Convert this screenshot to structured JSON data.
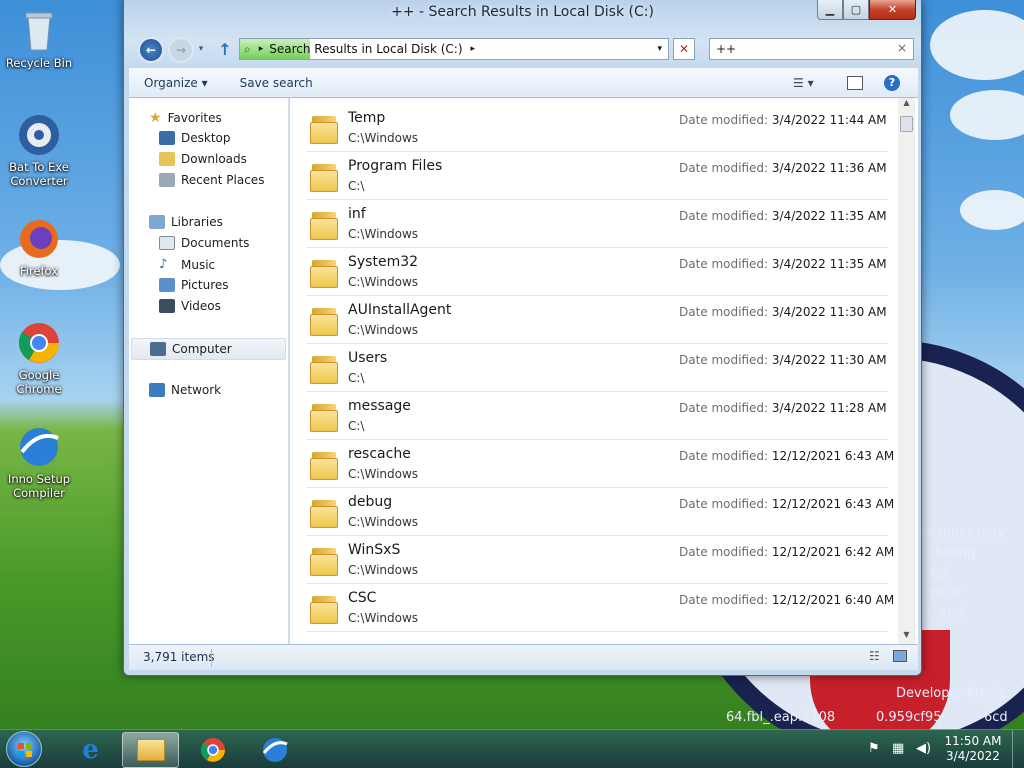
{
  "window": {
    "title": "++ - Search Results in Local Disk (C:)",
    "min": "▁",
    "max": "▢",
    "close": "✕"
  },
  "address": {
    "text": "Search Results in Local Disk (C:)",
    "sep": "▸"
  },
  "search": {
    "value": "++",
    "clear": "×"
  },
  "toolbar": {
    "organize": "Organize ▾",
    "save_search": "Save search"
  },
  "nav": {
    "favorites": "Favorites",
    "desktop": "Desktop",
    "downloads": "Downloads",
    "recent": "Recent Places",
    "libraries": "Libraries",
    "documents": "Documents",
    "music": "Music",
    "pictures": "Pictures",
    "videos": "Videos",
    "computer": "Computer",
    "network": "Network"
  },
  "date_label": "Date modified:",
  "rows": [
    {
      "name": "Temp",
      "path": "C:\\Windows",
      "date": "3/4/2022 11:44 AM"
    },
    {
      "name": "Program Files",
      "path": "C:\\",
      "date": "3/4/2022 11:36 AM"
    },
    {
      "name": "inf",
      "path": "C:\\Windows",
      "date": "3/4/2022 11:35 AM"
    },
    {
      "name": "System32",
      "path": "C:\\Windows",
      "date": "3/4/2022 11:35 AM"
    },
    {
      "name": "AUInstallAgent",
      "path": "C:\\Windows",
      "date": "3/4/2022 11:30 AM"
    },
    {
      "name": "Users",
      "path": "C:\\",
      "date": "3/4/2022 11:30 AM"
    },
    {
      "name": "message",
      "path": "C:\\",
      "date": "3/4/2022 11:28 AM"
    },
    {
      "name": "rescache",
      "path": "C:\\Windows",
      "date": "12/12/2021 6:43 AM"
    },
    {
      "name": "debug",
      "path": "C:\\Windows",
      "date": "12/12/2021 6:43 AM"
    },
    {
      "name": "WinSxS",
      "path": "C:\\Windows",
      "date": "12/12/2021 6:42 AM"
    },
    {
      "name": "CSC",
      "path": "C:\\Windows",
      "date": "12/12/2021 6:40 AM"
    }
  ],
  "status": {
    "items": "3,791 items"
  },
  "desktop": {
    "recycle": "Recycle Bin",
    "bat": "Bat To Exe Converter",
    "firefox": "Firefox",
    "chrome": "Google Chrome",
    "inno": "Inno Setup Compiler"
  },
  "wallpaper": {
    "t1": "manner may",
    "t2": "cluding",
    "t3": "ept",
    "t4": "nt or",
    "t5": "), and",
    "t6": "Developer Previe",
    "t7": "64.fbl_.eap.1108",
    "t8": "0.959cf95",
    "t9": "6cd"
  },
  "clock": {
    "time": "11:50 AM",
    "date": "3/4/2022"
  }
}
